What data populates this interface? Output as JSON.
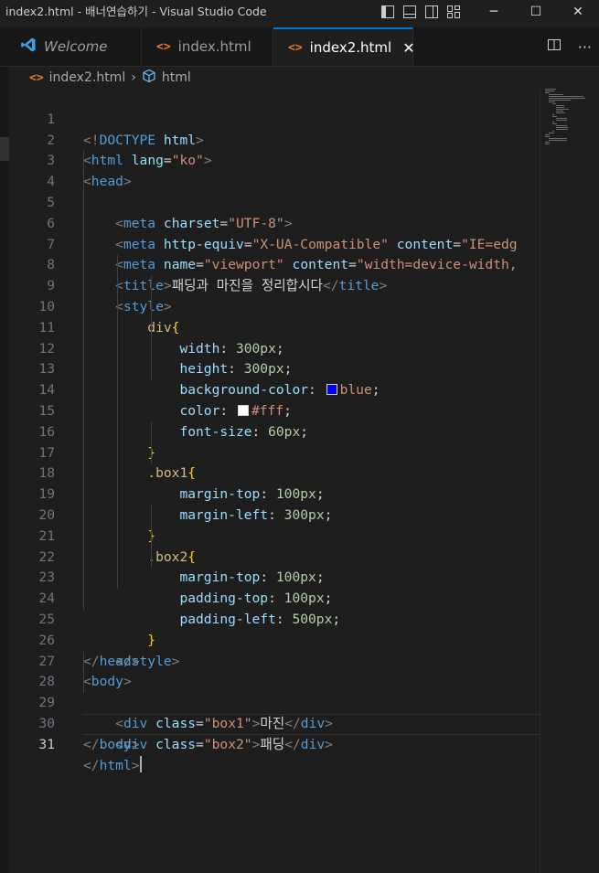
{
  "window": {
    "title": "index2.html - 배너연습하기 - Visual Studio Code",
    "controls": {
      "minimize": "─",
      "maximize": "☐",
      "close": "✕"
    }
  },
  "tabs": [
    {
      "label": "Welcome",
      "icon": "vscode-logo-icon",
      "active": false
    },
    {
      "label": "index.html",
      "icon": "html-file-icon",
      "active": false
    },
    {
      "label": "index2.html",
      "icon": "html-file-icon",
      "active": true,
      "close": "✕"
    }
  ],
  "tab_actions": {
    "split": "split-editor-icon",
    "more": "···"
  },
  "breadcrumb": {
    "file": "index2.html",
    "separator": "›",
    "symbol": "html"
  },
  "editor": {
    "current_line": 31,
    "line_numbers": [
      "1",
      "2",
      "3",
      "4",
      "5",
      "6",
      "7",
      "8",
      "9",
      "10",
      "11",
      "12",
      "13",
      "14",
      "15",
      "16",
      "17",
      "18",
      "19",
      "20",
      "21",
      "22",
      "23",
      "24",
      "25",
      "26",
      "27",
      "28",
      "29",
      "30",
      "31"
    ],
    "tokens": {
      "l1": [
        "<!",
        "DOCTYPE",
        " ",
        "html",
        ">"
      ],
      "l2": [
        "<",
        "html",
        " ",
        "lang",
        "=",
        "\"ko\"",
        ">"
      ],
      "l3": [
        "<",
        "head",
        ">"
      ],
      "l4": [
        "<",
        "meta",
        " ",
        "charset",
        "=",
        "\"UTF-8\"",
        ">"
      ],
      "l5": [
        "<",
        "meta",
        " ",
        "http-equiv",
        "=",
        "\"X-UA-Compatible\"",
        " ",
        "content",
        "=",
        "\"IE=edg"
      ],
      "l6": [
        "<",
        "meta",
        " ",
        "name",
        "=",
        "\"viewport\"",
        " ",
        "content",
        "=",
        "\"width=device-width,"
      ],
      "l7": [
        "<",
        "title",
        ">",
        "패딩과 마진을 정리합시다",
        "</",
        "title",
        ">"
      ],
      "l8": [
        "<",
        "style",
        ">"
      ],
      "l9": [
        "div",
        "{"
      ],
      "l10": [
        "width",
        ": ",
        "300px",
        ";"
      ],
      "l11": [
        "height",
        ": ",
        "300px",
        ";"
      ],
      "l12": [
        "background-color",
        ": ",
        "blue",
        ";"
      ],
      "l13": [
        "color",
        ": ",
        "#fff",
        ";"
      ],
      "l14": [
        "font-size",
        ": ",
        "60px",
        ";"
      ],
      "l15": [
        "}"
      ],
      "l16": [
        ".box1",
        "{"
      ],
      "l17": [
        "margin-top",
        ": ",
        "100px",
        ";"
      ],
      "l18": [
        "margin-left",
        ": ",
        "300px",
        ";"
      ],
      "l19": [
        "}"
      ],
      "l20": [
        ".box2",
        "{"
      ],
      "l21": [
        "margin-top",
        ": ",
        "100px",
        ";"
      ],
      "l22": [
        "padding-top",
        ": ",
        "100px",
        ";"
      ],
      "l23": [
        "padding-left",
        ": ",
        "500px",
        ";"
      ],
      "l24": [
        "}"
      ],
      "l25": [
        "</",
        "style",
        ">"
      ],
      "l26": [
        "</",
        "head",
        ">"
      ],
      "l27": [
        "<",
        "body",
        ">"
      ],
      "l28": [
        "<",
        "div",
        " ",
        "class",
        "=",
        "\"box1\"",
        ">",
        "마진",
        "</",
        "div",
        ">"
      ],
      "l29": [
        "<",
        "div",
        " ",
        "class",
        "=",
        "\"box2\"",
        ">",
        "패딩",
        "</",
        "div",
        ">"
      ],
      "l30": [
        "</",
        "body",
        ">"
      ],
      "l31": [
        "</",
        "html",
        ">"
      ]
    },
    "swatch_colors": {
      "blue": "#0000ff",
      "white": "#ffffff"
    }
  }
}
